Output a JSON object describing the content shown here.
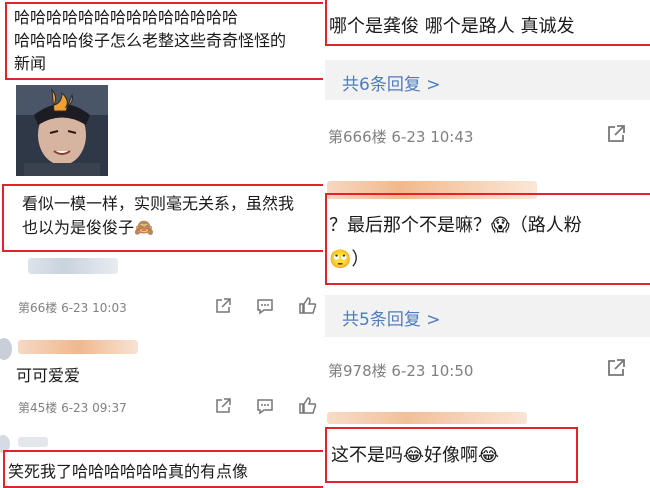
{
  "left": {
    "comment1_line1": "哈哈哈哈哈哈哈哈哈哈哈哈哈哈",
    "comment1_line2": "哈哈哈哈俊子怎么老整这些奇奇怪怪的",
    "comment1_line3": "新闻",
    "comment2_line1": "看似一模一样，实则毫无关系，虽然我",
    "comment2_line2": "也以为是俊俊子🙈",
    "meta1": "第66楼  6-23 10:03",
    "comment3": "可可爱爱",
    "meta2": "第45楼  6-23 09:37",
    "comment4": "笑死我了哈哈哈哈哈哈真的有点像"
  },
  "right": {
    "comment1": "哪个是龚俊 哪个是路人 真诚发",
    "replies1": "共6条回复 >",
    "meta1": "第666楼  6-23 10:43",
    "comment2_line1": "？最后那个不是嘛？😱（路人粉",
    "comment2_line2": "🙄）",
    "replies2": "共5条回复 >",
    "meta2": "第978楼  6-23 10:50",
    "comment3": "这不是吗😂好像啊😂"
  },
  "colors": {
    "highlight": "#e0242a",
    "link": "#4f7bbf",
    "meta": "#808080"
  }
}
